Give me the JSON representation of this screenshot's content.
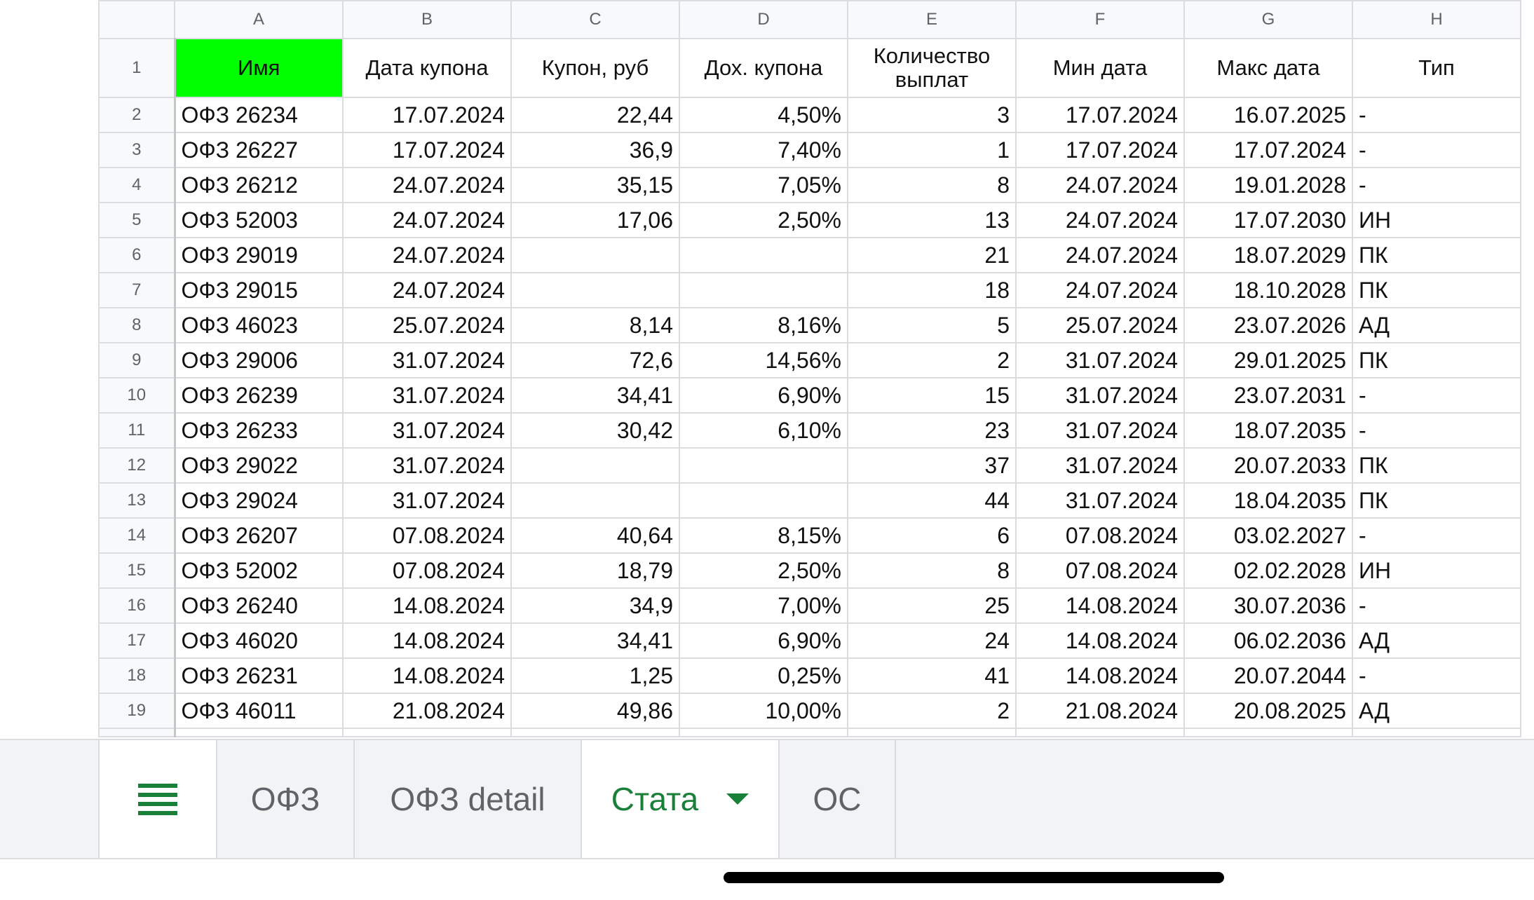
{
  "columns": [
    "A",
    "B",
    "C",
    "D",
    "E",
    "F",
    "G",
    "H"
  ],
  "header_row_number": "1",
  "headers": [
    "Имя",
    "Дата купона",
    "Купон, руб",
    "Дох. купона",
    "Количество выплат",
    "Мин дата",
    "Макс дата",
    "Тип"
  ],
  "colors": {
    "highlight": "#00ff00",
    "active_tab": "#188038"
  },
  "rows": [
    {
      "n": "2",
      "name": "ОФЗ 26234",
      "date": "17.07.2024",
      "coupon": "22,44",
      "yield": "4,50%",
      "count": "3",
      "min": "17.07.2024",
      "max": "16.07.2025",
      "type": "-"
    },
    {
      "n": "3",
      "name": "ОФЗ 26227",
      "date": "17.07.2024",
      "coupon": "36,9",
      "yield": "7,40%",
      "count": "1",
      "min": "17.07.2024",
      "max": "17.07.2024",
      "type": "-"
    },
    {
      "n": "4",
      "name": "ОФЗ 26212",
      "date": "24.07.2024",
      "coupon": "35,15",
      "yield": "7,05%",
      "count": "8",
      "min": "24.07.2024",
      "max": "19.01.2028",
      "type": "-"
    },
    {
      "n": "5",
      "name": "ОФЗ 52003",
      "date": "24.07.2024",
      "coupon": "17,06",
      "yield": "2,50%",
      "count": "13",
      "min": "24.07.2024",
      "max": "17.07.2030",
      "type": "ИН"
    },
    {
      "n": "6",
      "name": "ОФЗ 29019",
      "date": "24.07.2024",
      "coupon": "",
      "yield": "",
      "count": "21",
      "min": "24.07.2024",
      "max": "18.07.2029",
      "type": "ПК"
    },
    {
      "n": "7",
      "name": "ОФЗ 29015",
      "date": "24.07.2024",
      "coupon": "",
      "yield": "",
      "count": "18",
      "min": "24.07.2024",
      "max": "18.10.2028",
      "type": "ПК"
    },
    {
      "n": "8",
      "name": "ОФЗ 46023",
      "date": "25.07.2024",
      "coupon": "8,14",
      "yield": "8,16%",
      "count": "5",
      "min": "25.07.2024",
      "max": "23.07.2026",
      "type": "АД"
    },
    {
      "n": "9",
      "name": "ОФЗ 29006",
      "date": "31.07.2024",
      "coupon": "72,6",
      "yield": "14,56%",
      "count": "2",
      "min": "31.07.2024",
      "max": "29.01.2025",
      "type": "ПК"
    },
    {
      "n": "10",
      "name": "ОФЗ 26239",
      "date": "31.07.2024",
      "coupon": "34,41",
      "yield": "6,90%",
      "count": "15",
      "min": "31.07.2024",
      "max": "23.07.2031",
      "type": "-"
    },
    {
      "n": "11",
      "name": "ОФЗ 26233",
      "date": "31.07.2024",
      "coupon": "30,42",
      "yield": "6,10%",
      "count": "23",
      "min": "31.07.2024",
      "max": "18.07.2035",
      "type": "-"
    },
    {
      "n": "12",
      "name": "ОФЗ 29022",
      "date": "31.07.2024",
      "coupon": "",
      "yield": "",
      "count": "37",
      "min": "31.07.2024",
      "max": "20.07.2033",
      "type": "ПК"
    },
    {
      "n": "13",
      "name": "ОФЗ 29024",
      "date": "31.07.2024",
      "coupon": "",
      "yield": "",
      "count": "44",
      "min": "31.07.2024",
      "max": "18.04.2035",
      "type": "ПК"
    },
    {
      "n": "14",
      "name": "ОФЗ 26207",
      "date": "07.08.2024",
      "coupon": "40,64",
      "yield": "8,15%",
      "count": "6",
      "min": "07.08.2024",
      "max": "03.02.2027",
      "type": "-"
    },
    {
      "n": "15",
      "name": "ОФЗ 52002",
      "date": "07.08.2024",
      "coupon": "18,79",
      "yield": "2,50%",
      "count": "8",
      "min": "07.08.2024",
      "max": "02.02.2028",
      "type": "ИН"
    },
    {
      "n": "16",
      "name": "ОФЗ 26240",
      "date": "14.08.2024",
      "coupon": "34,9",
      "yield": "7,00%",
      "count": "25",
      "min": "14.08.2024",
      "max": "30.07.2036",
      "type": "-"
    },
    {
      "n": "17",
      "name": "ОФЗ 46020",
      "date": "14.08.2024",
      "coupon": "34,41",
      "yield": "6,90%",
      "count": "24",
      "min": "14.08.2024",
      "max": "06.02.2036",
      "type": "АД"
    },
    {
      "n": "18",
      "name": "ОФЗ 26231",
      "date": "14.08.2024",
      "coupon": "1,25",
      "yield": "0,25%",
      "count": "41",
      "min": "14.08.2024",
      "max": "20.07.2044",
      "type": "-"
    },
    {
      "n": "19",
      "name": "ОФЗ 46011",
      "date": "21.08.2024",
      "coupon": "49,86",
      "yield": "10,00%",
      "count": "2",
      "min": "21.08.2024",
      "max": "20.08.2025",
      "type": "АД"
    }
  ],
  "sheet_tabs": {
    "menu_icon": "hamburger-menu-icon",
    "tabs": [
      "ОФЗ",
      "ОФЗ detail",
      "Стата",
      "ОС"
    ],
    "active_index": 2
  }
}
